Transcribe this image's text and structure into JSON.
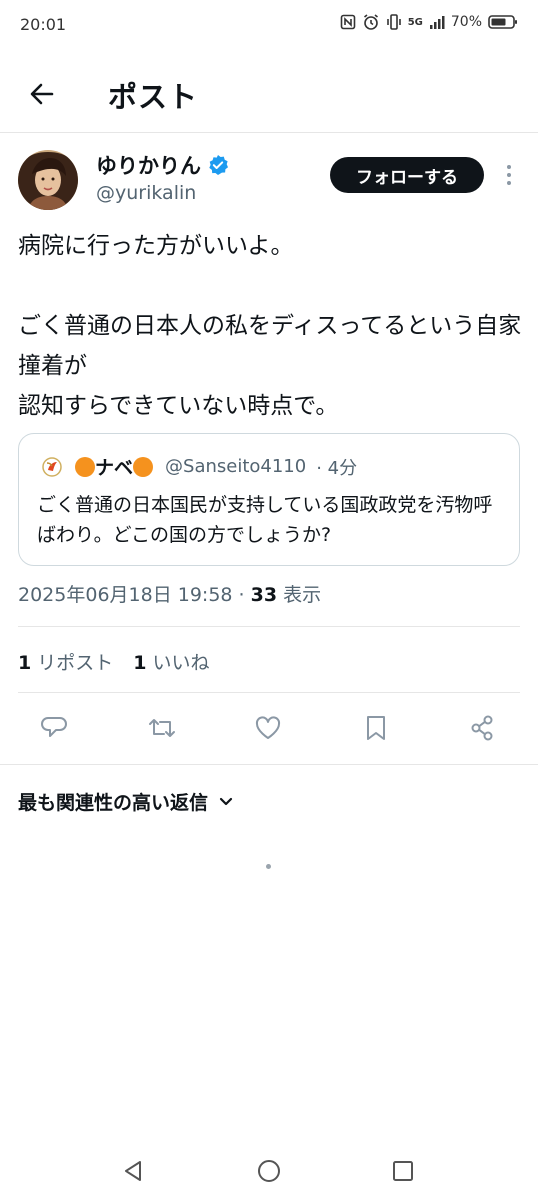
{
  "status_bar": {
    "time": "20:01",
    "network": "5G",
    "battery": "70%"
  },
  "header": {
    "title": "ポスト"
  },
  "author": {
    "name": "ゆりかりん",
    "handle": "@yurikalin",
    "verified": true
  },
  "follow_button": "フォローする",
  "tweet": {
    "text": "病院に行った方がいいよ。\n\nごく普通の日本人の私をディスってるという自家撞着が\n認知すらできていない時点で。"
  },
  "quote": {
    "name_prefix": "ナベ",
    "handle": "@Sanseito4110",
    "time": "· 4分",
    "text": "ごく普通の日本国民が支持している国政政党を汚物呼ばわり。どこの国の方でしょうか?"
  },
  "meta": {
    "timestamp": "2025年06月18日 19:58 · ",
    "views_count": "33",
    "views_label": " 表示"
  },
  "stats": {
    "reposts_count": "1",
    "reposts_label": " リポスト",
    "likes_count": "1",
    "likes_label": " いいね"
  },
  "replies": {
    "sort_label": "最も関連性の高い返信"
  },
  "colors": {
    "text": "#0f1419",
    "secondary": "#536471",
    "verified": "#1d9bf0",
    "follow_bg": "#0f1419",
    "emoji_orange": "#f5921e"
  }
}
